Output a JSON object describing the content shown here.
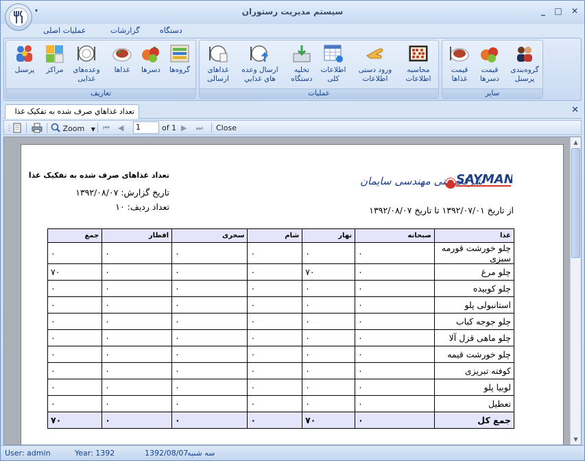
{
  "window": {
    "title": "سیستم مدیریت رستوران",
    "qat_symbol": "▾",
    "minimize": "_",
    "maximize": "□",
    "close": "✕"
  },
  "ribbon_tabs": [
    "عملیات اصلی",
    "گزارشات",
    "دستگاه"
  ],
  "groups": {
    "definitions": {
      "title": "تعاریف",
      "buttons": [
        "پرسنل",
        "مراکز",
        "وعده‌های غذایی",
        "غذاها",
        "دسرها",
        "گروه‌ها"
      ]
    },
    "operations": {
      "title": "عملیات",
      "buttons": [
        "غذاهای ارسالی",
        "ارسال وعده هاي غذايي",
        "تخلیه دستگاه",
        "اطلاعات کلی",
        "ورود دستی اطلاعات",
        "محاسبه اطلاعات"
      ]
    },
    "other": {
      "title": "سایر",
      "buttons": [
        "قیمت غذاها",
        "قیمت دسرها",
        "گروه‌بندی پرسنل"
      ]
    }
  },
  "doc_tab": {
    "label": "تعداد غذاهاي صرف شده به تفکيک غذا",
    "close": "✕"
  },
  "toolbar": {
    "zoom": "Zoom",
    "page": "1",
    "of": "of 1",
    "close": "Close"
  },
  "report": {
    "title": "تعداد غذاهای صرف شده به تفکیک غذا",
    "report_date": "تاریخ گزارش: ۱۳۹۲/۰۸/۰۷",
    "row_count": "تعداد ردیف: ۱۰",
    "logo_company": "شرکت فنی مهندسی سایمان",
    "logo_brand": "SAYMAN",
    "period": "از تاریخ ۱۳۹۲/۰۷/۰۱ تا تاریخ ۱۳۹۲/۰۸/۰۷",
    "columns": [
      "غذا",
      "صبحانه",
      "نهار",
      "شام",
      "سحری",
      "افطار",
      "جمع"
    ],
    "rows": [
      [
        "چلو خورشت قورمه سبزی",
        "۰",
        "۰",
        "۰",
        "۰",
        "۰",
        "۰"
      ],
      [
        "چلو مرغ",
        "۰",
        "۷۰",
        "۰",
        "۰",
        "۰",
        "۷۰"
      ],
      [
        "چلو کوبیده",
        "۰",
        "۰",
        "۰",
        "۰",
        "۰",
        "۰"
      ],
      [
        "استانبولی پلو",
        "۰",
        "۰",
        "۰",
        "۰",
        "۰",
        "۰"
      ],
      [
        "چلو جوجه کباب",
        "۰",
        "۰",
        "۰",
        "۰",
        "۰",
        "۰"
      ],
      [
        "چلو ماهی قزل آلا",
        "۰",
        "۰",
        "۰",
        "۰",
        "۰",
        "۰"
      ],
      [
        "چلو خورشت قیمه",
        "۰",
        "۰",
        "۰",
        "۰",
        "۰",
        "۰"
      ],
      [
        "کوفته تبریزی",
        "۰",
        "۰",
        "۰",
        "۰",
        "۰",
        "۰"
      ],
      [
        "لوبیا پلو",
        "۰",
        "۰",
        "۰",
        "۰",
        "۰",
        "۰"
      ],
      [
        "تعطیل",
        "۰",
        "۰",
        "۰",
        "۰",
        "۰",
        "۰"
      ]
    ],
    "total_row": [
      "جمع کل",
      "۰",
      "۷۰",
      "۰",
      "۰",
      "۰",
      "۷۰"
    ]
  },
  "status": {
    "user": "User: admin",
    "year": "Year: 1392",
    "date": "1392/08/07",
    "weekday": "سه شنبه"
  }
}
